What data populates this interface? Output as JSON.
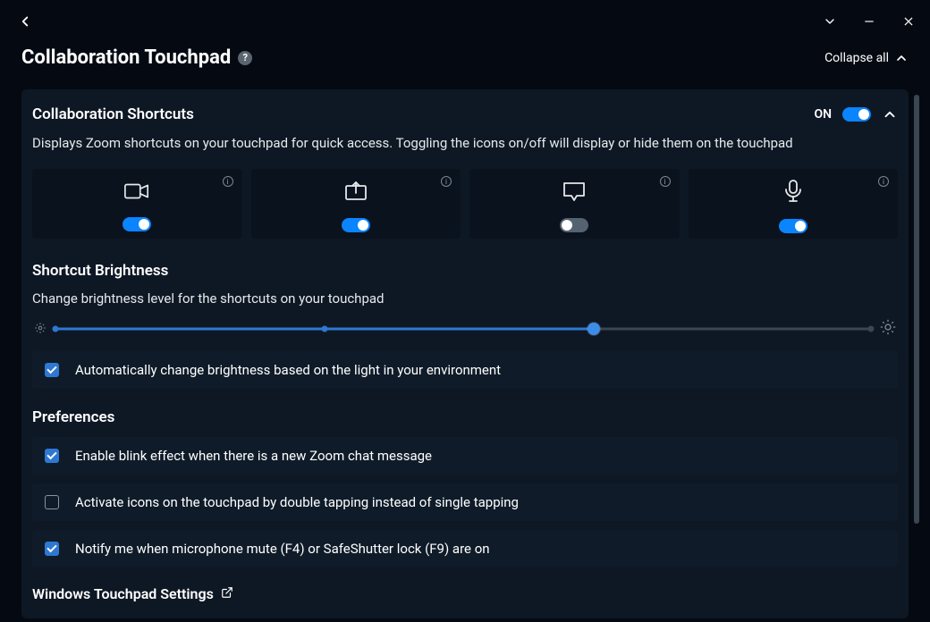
{
  "page": {
    "title": "Collaboration Touchpad",
    "collapse_all": "Collapse all"
  },
  "section_collab": {
    "title": "Collaboration Shortcuts",
    "status": "ON",
    "toggle_on": true,
    "desc": "Displays Zoom shortcuts on your touchpad for quick access. Toggling the icons on/off will display or hide them on the touchpad",
    "cards": [
      {
        "icon": "video-icon",
        "on": true
      },
      {
        "icon": "share-icon",
        "on": true
      },
      {
        "icon": "chat-icon",
        "on": false
      },
      {
        "icon": "mic-icon",
        "on": true
      }
    ]
  },
  "brightness": {
    "title": "Shortcut Brightness",
    "desc": "Change brightness level for the shortcuts on your touchpad",
    "value_pct": 66,
    "auto_label": "Automatically change brightness based on the light in your environment",
    "auto_checked": true
  },
  "prefs": {
    "title": "Preferences",
    "items": [
      {
        "label": "Enable blink effect when there is a new Zoom chat message",
        "checked": true
      },
      {
        "label": "Activate icons on the touchpad by double tapping instead of single tapping",
        "checked": false
      },
      {
        "label": "Notify me when microphone mute (F4) or SafeShutter lock (F9) are on",
        "checked": true
      }
    ]
  },
  "ext_link": {
    "label": "Windows Touchpad Settings"
  }
}
